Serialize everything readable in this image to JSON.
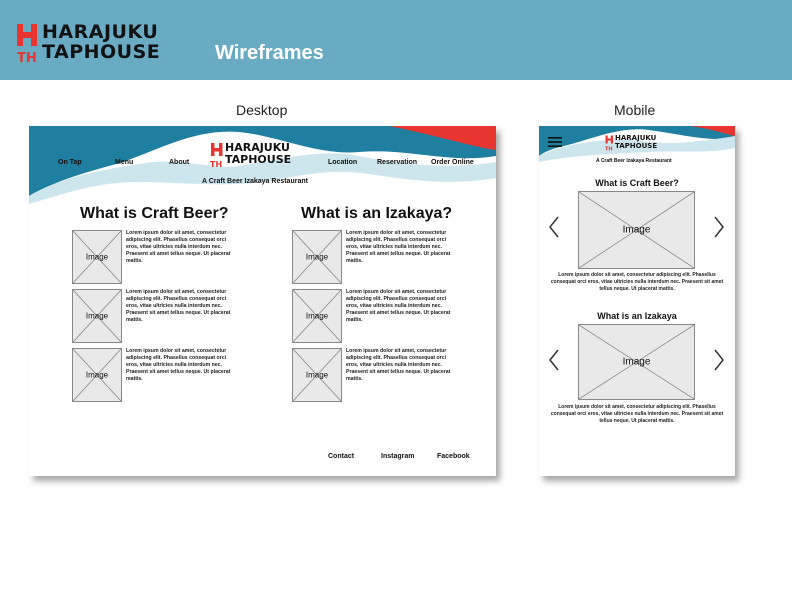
{
  "banner": {
    "logo_initials_top": "H",
    "logo_initials_bottom": "TH",
    "logo_line1": "HARAJUKU",
    "logo_line2": "TAPHOUSE",
    "title": "Wireframes",
    "bg_color": "#6aabc4",
    "accent_color": "#e8352f"
  },
  "labels": {
    "desktop": "Desktop",
    "mobile": "Mobile"
  },
  "desktop": {
    "nav": [
      "On Tap",
      "Menu",
      "About",
      "Location",
      "Reservation",
      "Order Online"
    ],
    "logo_line1": "HARAJUKU",
    "logo_line2": "TAPHOUSE",
    "tagline": "A Craft Beer Izakaya Restaurant",
    "columns": [
      {
        "title": "What is Craft Beer?",
        "items": [
          {
            "image": "Image",
            "text": "Lorem ipsum dolor sit amet, consectetur adipiscing elit. Phasellus consequat orci eros, vitae ultricies nulla interdum nec. Praesent sit amet tellus neque. Ut placerat mattis."
          },
          {
            "image": "Image",
            "text": "Lorem ipsum dolor sit amet, consectetur adipiscing elit. Phasellus consequat orci eros, vitae ultricies nulla interdum nec. Praesent sit amet tellus neque. Ut placerat mattis."
          },
          {
            "image": "Image",
            "text": "Lorem ipsum dolor sit amet, consectetur adipiscing elit. Phasellus consequat orci eros, vitae ultricies nulla interdum nec. Praesent sit amet tellus neque. Ut placerat mattis."
          }
        ]
      },
      {
        "title": "What is an Izakaya?",
        "items": [
          {
            "image": "Image",
            "text": "Lorem ipsum dolor sit amet, consectetur adipiscing elit. Phasellus consequat orci eros, vitae ultricies nulla interdum nec. Praesent sit amet tellus neque. Ut placerat mattis."
          },
          {
            "image": "Image",
            "text": "Lorem ipsum dolor sit amet, consectetur adipiscing elit. Phasellus consequat orci eros, vitae ultricies nulla interdum nec. Praesent sit amet tellus neque. Ut placerat mattis."
          },
          {
            "image": "Image",
            "text": "Lorem ipsum dolor sit amet, consectetur adipiscing elit. Phasellus consequat orci eros, vitae ultricies nulla interdum nec. Praesent sit amet tellus neque. Ut placerat mattis."
          }
        ]
      }
    ],
    "footer": [
      "Contact",
      "Instagram",
      "Facebook"
    ]
  },
  "mobile": {
    "menu_icon": "hamburger-icon",
    "logo_line1": "HARAJUKU",
    "logo_line2": "TAPHOUSE",
    "tagline": "A Craft Beer Izakaya Restaurant",
    "sections": [
      {
        "title": "What is Craft Beer?",
        "image": "Image",
        "text": "Lorem ipsum dolor sit amet, consectetur adipiscing elit. Phasellus consequat orci eros, vitae ultricies nulla interdum nec. Praesent sit amet tellus neque. Ut placerat mattis."
      },
      {
        "title": "What is an Izakaya",
        "image": "Image",
        "text": "Lorem ipsum dolor sit amet, consectetur adipiscing elit. Phasellus consequat orci eros, vitae ultricies nulla interdum nec. Praesent sit amet tellus neque. Ut placerat mattis."
      }
    ]
  },
  "colors": {
    "wave_dark": "#1f7fa0",
    "wave_light": "#cde6ee",
    "wave_red": "#e8352f",
    "placeholder": "#e9e9e9"
  }
}
